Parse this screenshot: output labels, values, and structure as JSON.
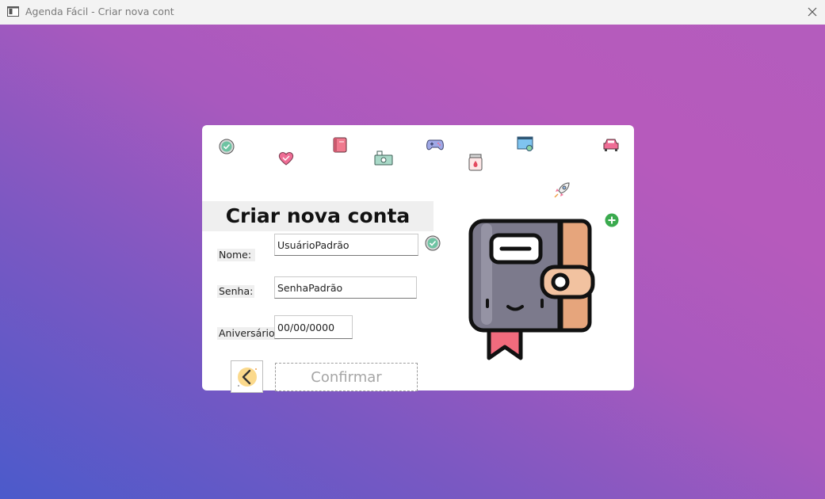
{
  "window": {
    "title": "Agenda Fácil - Criar nova cont"
  },
  "form": {
    "heading": "Criar nova conta",
    "name_label": "Nome:",
    "name_value": "UsuárioPadrão",
    "password_label": "Senha:",
    "password_value": "SenhaPadrão",
    "birthday_label": "Aniversário:",
    "birthday_value": "00/00/0000",
    "confirm_label": "Confirmar"
  },
  "icons": [
    "app-window-icon",
    "close-icon",
    "check-badge-icon",
    "heart-icon",
    "book-icon",
    "money-icon",
    "gamepad-icon",
    "jar-icon",
    "monitor-icon",
    "rocket-icon",
    "car-icon",
    "add-circle-icon",
    "wallet-illustration",
    "back-arrow-icon"
  ],
  "colors": {
    "background_start": "#4b5acb",
    "background_end": "#b65abc",
    "card": "#ffffff",
    "accent_green": "#3aaa4e"
  }
}
